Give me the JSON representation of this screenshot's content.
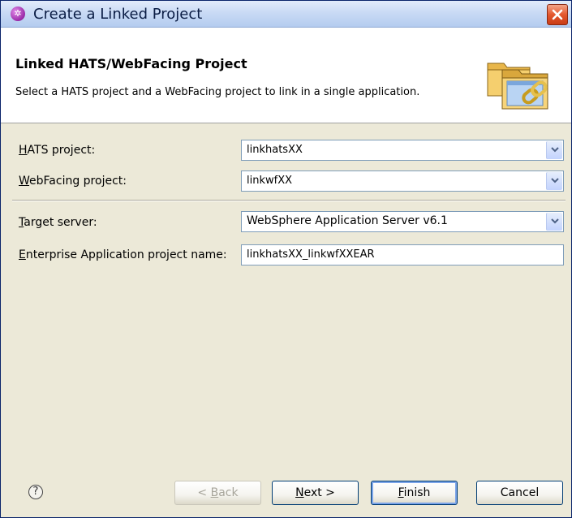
{
  "window": {
    "title": "Create a Linked Project"
  },
  "banner": {
    "title": "Linked HATS/WebFacing Project",
    "description": "Select a HATS project and a WebFacing project to link in a single application."
  },
  "form": {
    "hats_project": {
      "label_mnemonic": "H",
      "label_rest": "ATS project:",
      "value": "linkhatsXX"
    },
    "webfacing_project": {
      "label_mnemonic": "W",
      "label_rest": "ebFacing project:",
      "value": "linkwfXX"
    },
    "target_server": {
      "label_mnemonic": "T",
      "label_rest": "arget server:",
      "value": "WebSphere Application Server v6.1"
    },
    "ear_project": {
      "label_mnemonic": "E",
      "label_rest": "nterprise Application project name:",
      "value": "linkhatsXX_linkwfXXEAR"
    }
  },
  "buttons": {
    "back": {
      "pre": "< ",
      "mnemonic": "B",
      "rest": "ack"
    },
    "next": {
      "mnemonic": "N",
      "rest": "ext >"
    },
    "finish": {
      "mnemonic": "F",
      "rest": "inish"
    },
    "cancel": {
      "label": "Cancel"
    },
    "help": {
      "glyph": "?"
    }
  },
  "icons": {
    "app": "eclipse-wizard-icon",
    "close": "close-icon",
    "banner": "linked-projects-icon",
    "dropdown": "chevron-down-icon",
    "help": "help-icon"
  },
  "colors": {
    "titlebar": "#c9daf5",
    "close_button": "#e4572e",
    "window_bg": "#ece9d8",
    "field_border": "#7f9db9"
  }
}
